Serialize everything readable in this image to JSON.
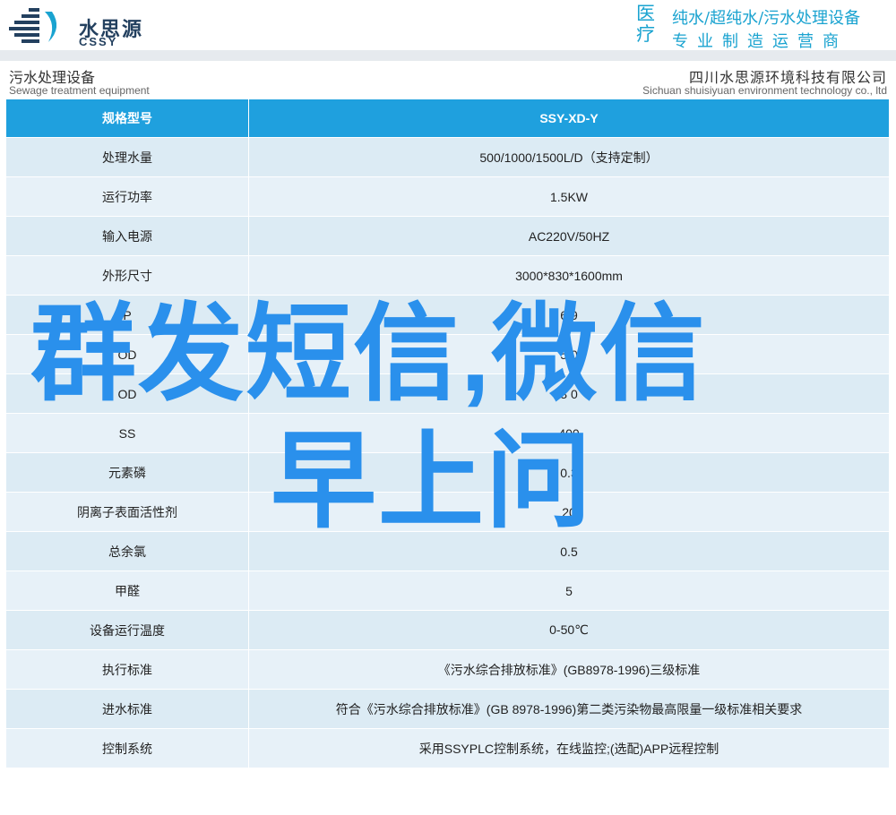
{
  "brand": {
    "name_cn": "水思源",
    "name_en": "CSSY",
    "slogan_big": "医疗",
    "slogan_line1": "纯水/超纯水/污水处理设备",
    "slogan_line2": "专业制造运营商"
  },
  "subtitle": {
    "left_cn": "污水处理设备",
    "left_en": "Sewage treatment equipment",
    "right_cn": "四川水思源环境科技有限公司",
    "right_en": "Sichuan shuisiyuan environment technology co., ltd"
  },
  "table": {
    "header": {
      "label": "规格型号",
      "value": "SSY-XD-Y"
    },
    "rows": [
      {
        "label": "处理水量",
        "value": "500/1000/1500L/D（支持定制）"
      },
      {
        "label": "运行功率",
        "value": "1.5KW"
      },
      {
        "label": "输入电源",
        "value": "AC220V/50HZ"
      },
      {
        "label": "外形尺寸",
        "value": "3000*830*1600mm"
      },
      {
        "label": "P",
        "value": "6 9"
      },
      {
        "label": "OD",
        "value": "5 0"
      },
      {
        "label": "OD",
        "value": "3 0"
      },
      {
        "label": "SS",
        "value": "400"
      },
      {
        "label": "元素磷",
        "value": "0.3"
      },
      {
        "label": "阴离子表面活性剂",
        "value": "20"
      },
      {
        "label": "总余氯",
        "value": "0.5"
      },
      {
        "label": "甲醛",
        "value": "5"
      },
      {
        "label": "设备运行温度",
        "value": "0-50℃"
      },
      {
        "label": "执行标准",
        "value": "《污水综合排放标准》(GB8978-1996)三级标准"
      },
      {
        "label": "进水标准",
        "value": "符合《污水综合排放标准》(GB 8978-1996)第二类污染物最高限量一级标准相关要求"
      },
      {
        "label": "控制系统",
        "value": "采用SSYPLC控制系统，在线监控;(选配)APP远程控制"
      }
    ]
  },
  "watermark": {
    "line1": "群发短信,微信",
    "line2": "早上问"
  },
  "colors": {
    "brand_dark": "#23405f",
    "accent": "#1aa3d0",
    "table_header": "#1fa0de",
    "row_a": "#dcebf4",
    "row_b": "#e7f1f8",
    "watermark": "#2a90ec"
  }
}
